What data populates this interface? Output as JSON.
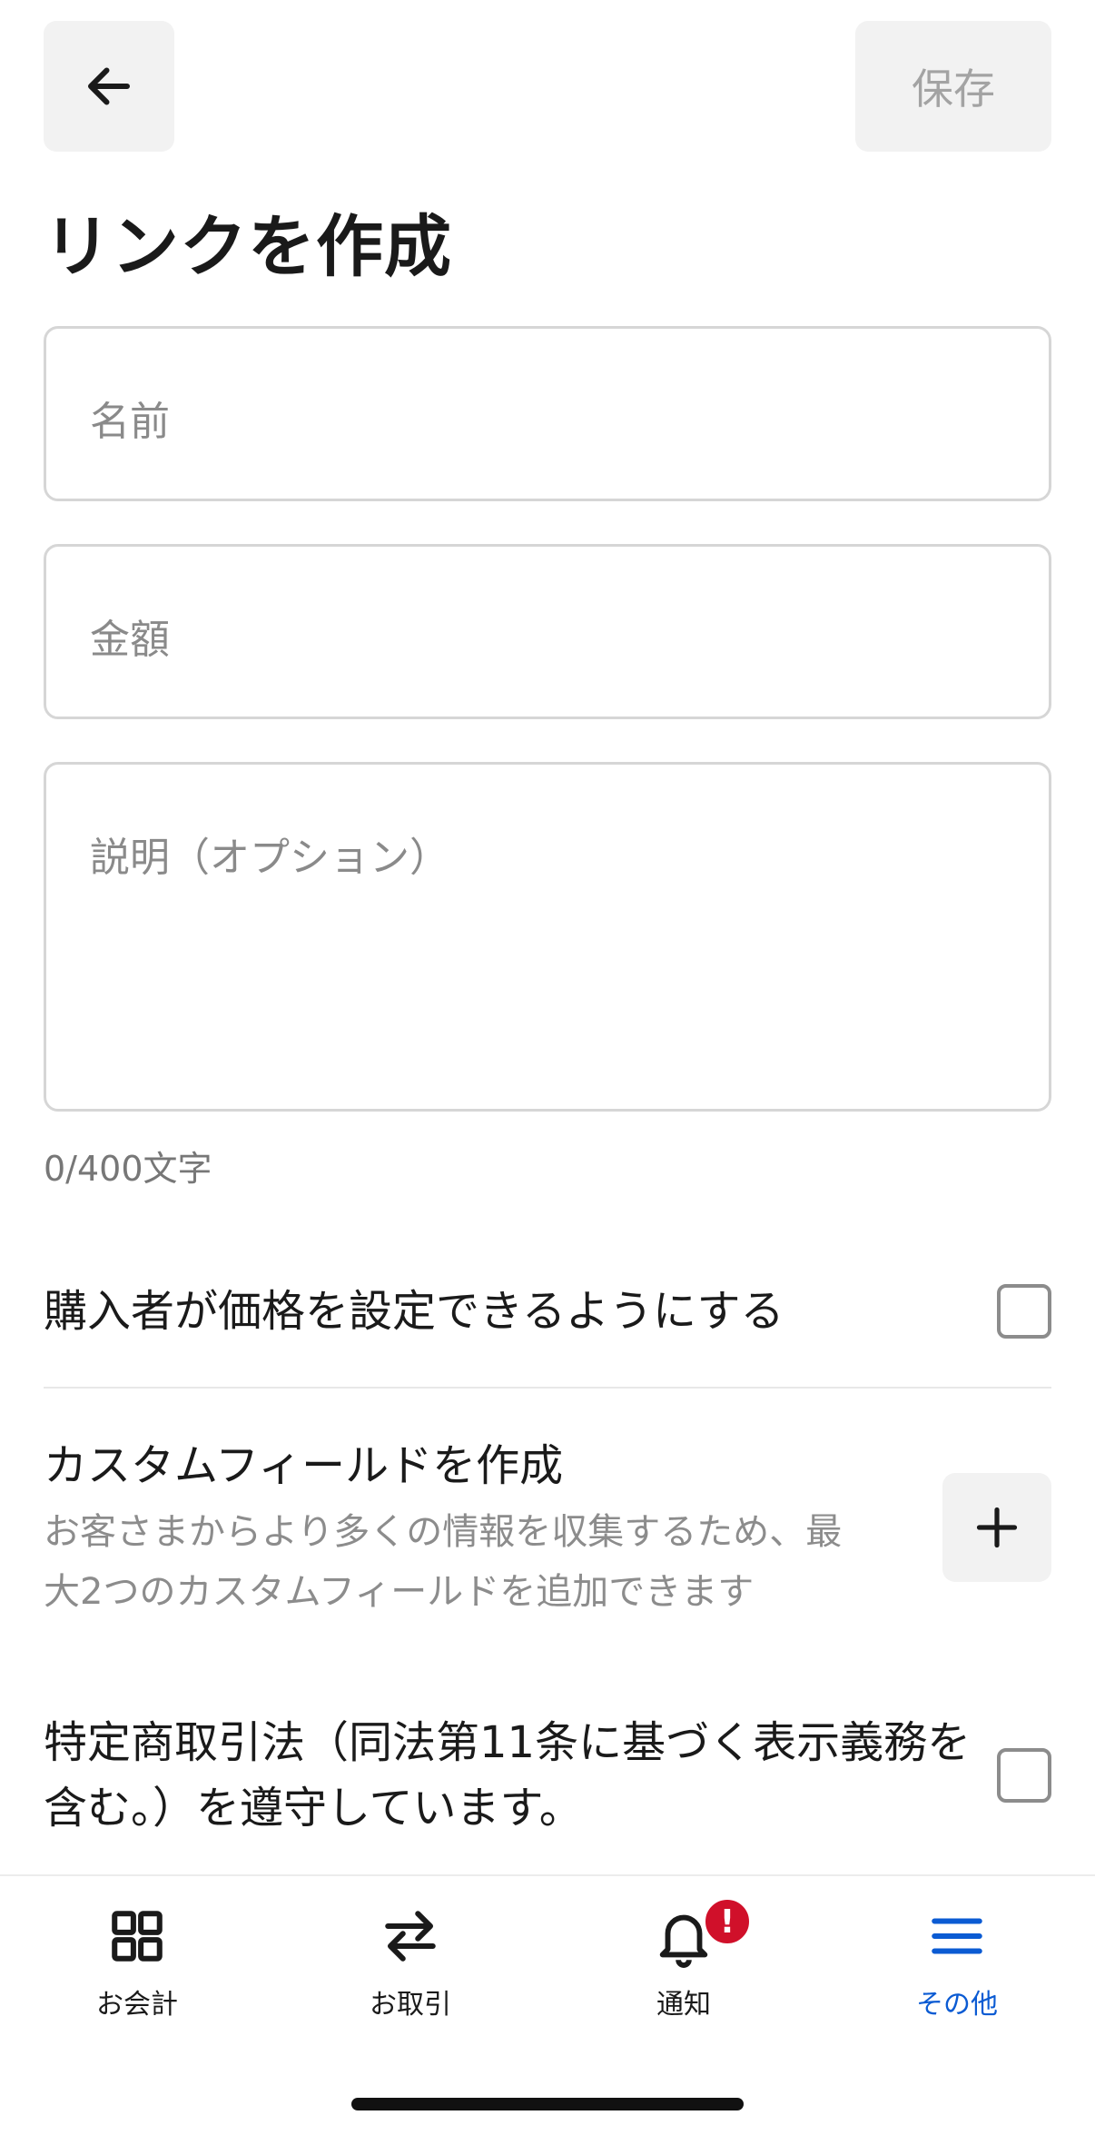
{
  "header": {
    "back_icon": "arrow-left-icon",
    "save_label": "保存"
  },
  "title": "リンクを作成",
  "form": {
    "name_placeholder": "名前",
    "amount_placeholder": "金額",
    "description_placeholder": "説明（オプション）",
    "char_count": "0/400文字"
  },
  "options": {
    "buyer_price_label": "購入者が価格を設定できるようにする",
    "buyer_price_checked": false,
    "custom_field_title": "カスタムフィールドを作成",
    "custom_field_line1": "お客さまからより多くの情報を収集するため、最",
    "custom_field_line2": "大2つのカスタムフィールドを追加できます",
    "legal_line1": "特定商取引法（同法第11条に基づく表示義務を",
    "legal_line2": "含む。）を遵守しています。",
    "legal_checked": false
  },
  "nav": {
    "items": [
      {
        "label": "お会計",
        "icon": "grid-icon"
      },
      {
        "label": "お取引",
        "icon": "swap-arrows-icon"
      },
      {
        "label": "通知",
        "icon": "bell-icon",
        "badge": "!"
      },
      {
        "label": "その他",
        "icon": "menu-icon",
        "active": true
      }
    ]
  },
  "colors": {
    "accent": "#0b5bd3",
    "badge": "#d0102a"
  }
}
